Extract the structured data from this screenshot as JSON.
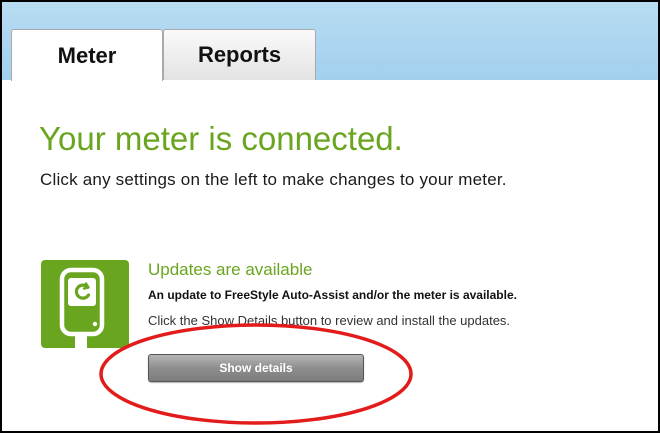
{
  "tabs": {
    "meter": "Meter",
    "reports": "Reports"
  },
  "main": {
    "heading": "Your meter is connected.",
    "subheading": "Click any settings on the left to make changes to your meter."
  },
  "updates": {
    "icon": "meter-device-icon",
    "title": "Updates are available",
    "description_bold": "An update to FreeStyle Auto-Assist and/or the meter is available.",
    "description": "Click the Show Details button to review and install the updates.",
    "button_label": "Show details"
  },
  "colors": {
    "accent_green": "#6aa51f",
    "tab_bar_blue": "#a2d0ee",
    "annotation_red": "#e31b1b"
  },
  "annotation": {
    "shape": "ellipse",
    "color": "red",
    "target": "show-details-button"
  }
}
